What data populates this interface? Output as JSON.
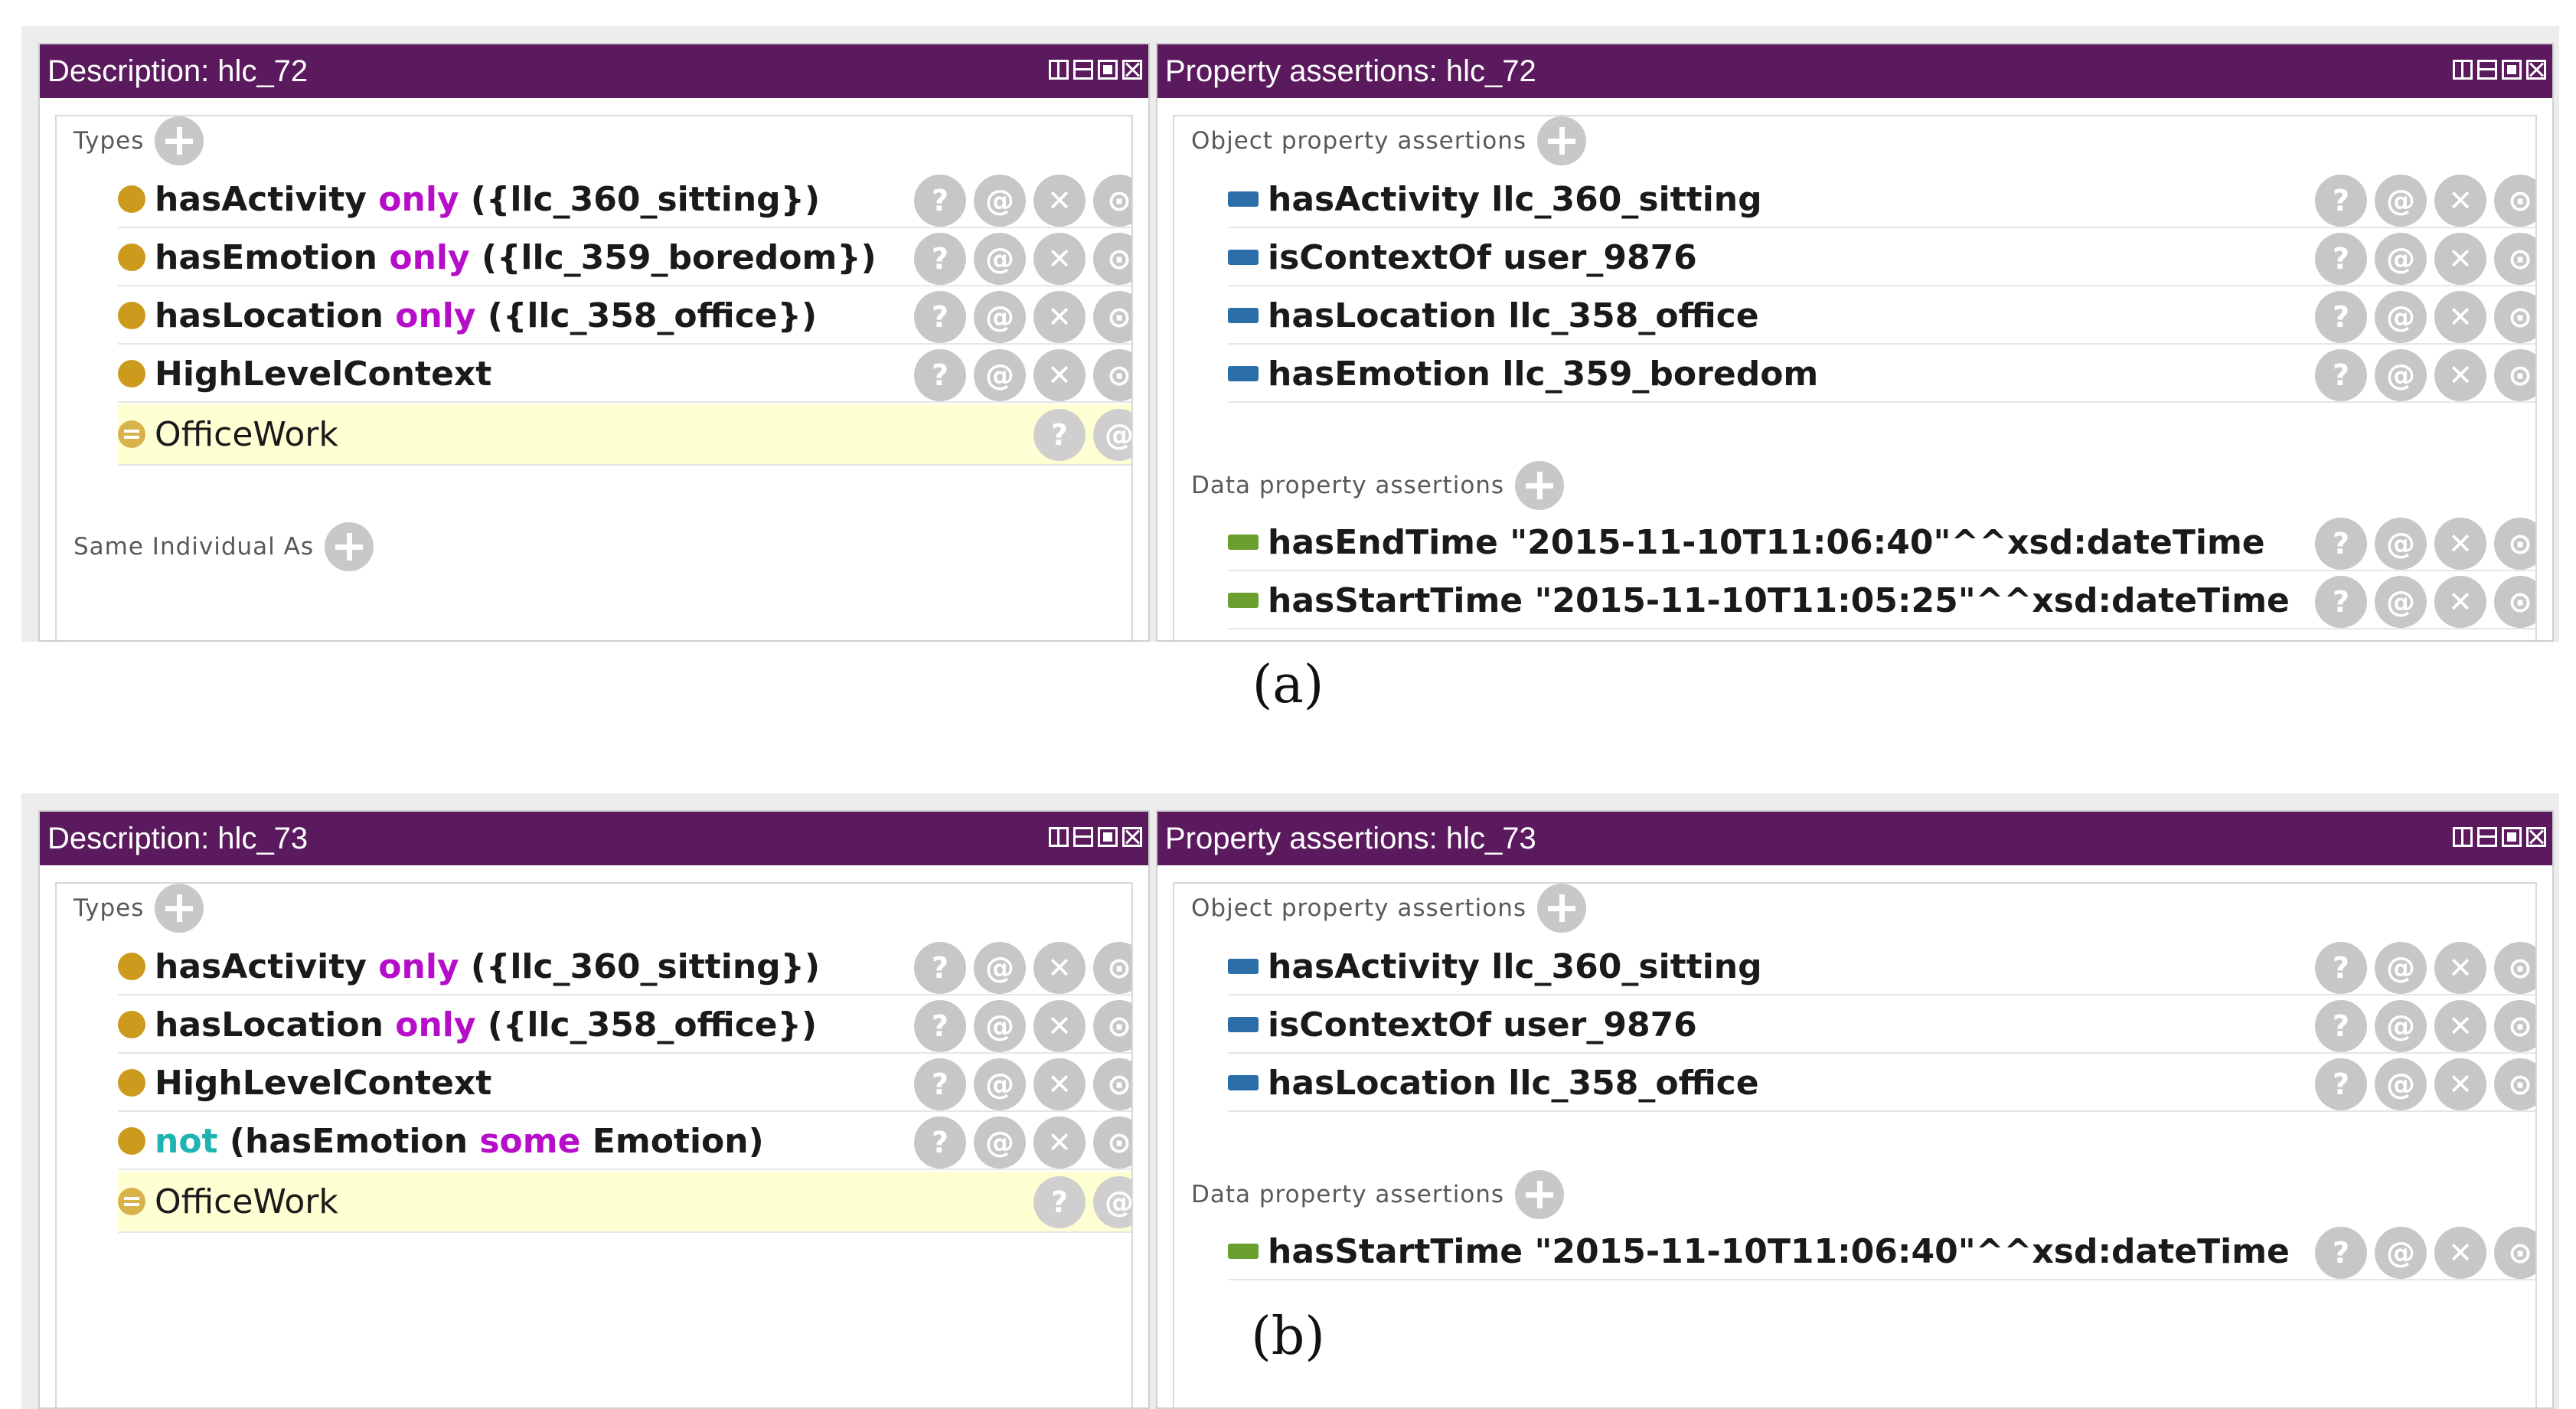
{
  "figures": [
    {
      "caption": "(a)",
      "left": {
        "title": "Description: hlc_72",
        "types_label": "Types",
        "same_label": "Same Individual As",
        "rows": [
          {
            "prop": "hasActivity",
            "kw": "only",
            "rest": " ({llc_360_sitting})"
          },
          {
            "prop": "hasEmotion",
            "kw": "only",
            "rest": " ({llc_359_boredom})"
          },
          {
            "prop": "hasLocation",
            "kw": "only",
            "rest": " ({llc_358_office})"
          },
          {
            "prop": "HighLevelContext",
            "kw": "",
            "rest": ""
          }
        ],
        "inferred": "OfficeWork"
      },
      "right": {
        "title": "Property assertions: hlc_72",
        "object_label": "Object property assertions",
        "data_label": "Data property assertions",
        "object_rows": [
          {
            "prop": "hasActivity",
            "value": "llc_360_sitting"
          },
          {
            "prop": "isContextOf",
            "value": "user_9876"
          },
          {
            "prop": "hasLocation",
            "value": "llc_358_office"
          },
          {
            "prop": "hasEmotion",
            "value": "llc_359_boredom"
          }
        ],
        "data_rows": [
          {
            "prop": "hasEndTime",
            "value": "\"2015-11-10T11:06:40\"^^xsd:dateTime"
          },
          {
            "prop": "hasStartTime",
            "value": "\"2015-11-10T11:05:25\"^^xsd:dateTime"
          }
        ]
      }
    },
    {
      "caption": "(b)",
      "left": {
        "title": "Description: hlc_73",
        "types_label": "Types",
        "rows": [
          {
            "prop": "hasActivity",
            "kw": "only",
            "rest": " ({llc_360_sitting})"
          },
          {
            "prop": "hasLocation",
            "kw": "only",
            "rest": " ({llc_358_office})"
          },
          {
            "prop": "HighLevelContext",
            "kw": "",
            "rest": ""
          },
          {
            "pre": "not",
            "prop": " (hasEmotion",
            "kw": "some",
            "rest": " Emotion)"
          }
        ],
        "inferred": "OfficeWork"
      },
      "right": {
        "title": "Property assertions: hlc_73",
        "object_label": "Object property assertions",
        "data_label": "Data property assertions",
        "object_rows": [
          {
            "prop": "hasActivity",
            "value": "llc_360_sitting"
          },
          {
            "prop": "isContextOf",
            "value": "user_9876"
          },
          {
            "prop": "hasLocation",
            "value": "llc_358_office"
          }
        ],
        "data_rows": [
          {
            "prop": "hasStartTime",
            "value": "\"2015-11-10T11:06:40\"^^xsd:dateTime"
          }
        ]
      }
    }
  ],
  "buttons": {
    "explain": "?",
    "annotate": "@",
    "delete": "✕",
    "edit": "⊙"
  },
  "colors": {
    "title_bar": "#5a1a5d",
    "keyword": "#b60dc8",
    "not_keyword": "#1fb3b3",
    "individual_dot": "#cc9a1c",
    "object_prop": "#2b6ea8",
    "data_prop": "#6b9f2f",
    "inferred_bg": "#ffffd4"
  },
  "icons": [
    "add-icon",
    "individual-icon",
    "class-icon",
    "object-property-icon",
    "data-property-icon",
    "explain-icon",
    "annotate-icon",
    "delete-icon",
    "edit-icon",
    "split-view-icon",
    "minimize-icon",
    "maximize-icon",
    "close-icon"
  ]
}
